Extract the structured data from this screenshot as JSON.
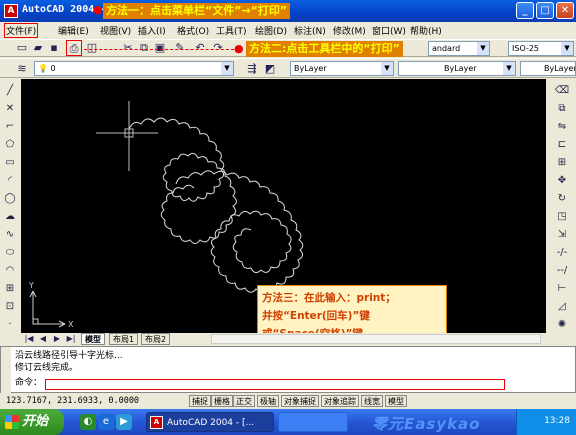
{
  "window": {
    "title": "AutoCAD 2004 -",
    "app_icon": "A",
    "minimize": "_",
    "maximize": "□",
    "close": "✕",
    "colors": {
      "titlebar": "#0a4fd8",
      "canvas": "#000000",
      "annotation_bg": "#e08000",
      "annotation_text": "#ffff00",
      "highlight": "#ee0000"
    }
  },
  "annotations": {
    "method1": "方法一：点击菜单栏“文件”→“打印”",
    "method2": "方法二:点击工具栏中的“打印”",
    "arrow": "●"
  },
  "menubar": {
    "items": [
      "文件(F)",
      "编辑(E)",
      "视图(V)",
      "插入(I)",
      "格式(O)",
      "工具(T)",
      "绘图(D)",
      "标注(N)",
      "修改(M)",
      "窗口(W)",
      "帮助(H)"
    ]
  },
  "toolbar": {
    "icons": [
      "new-icon",
      "open-icon",
      "save-icon",
      "print-icon",
      "preview-icon",
      "cut-icon",
      "copy-icon",
      "paste-icon",
      "matchprop-icon",
      "undo-icon",
      "redo-icon"
    ],
    "text_style": "andard",
    "dim_style": "ISO-25",
    "layer": "0",
    "color": "ByLayer",
    "linetype": "ByLayer",
    "lineweight": "ByLayer"
  },
  "canvas": {
    "ucs_y": "Y",
    "ucs_x": "X",
    "tip_lines": [
      "方法三：在此输入：print；",
      "并按“Enter(回车)”键",
      "或“Space(空格)”键"
    ]
  },
  "tabs": {
    "model": "模型",
    "layout1": "布局1",
    "layout2": "布局2"
  },
  "command": {
    "history": [
      "沿云线路径引导十字光标...",
      "修订云线完成。"
    ],
    "prompt": "命令："
  },
  "statusbar": {
    "coords": "123.7167, 231.6933, 0.0000",
    "toggles": [
      "捕捉",
      "栅格",
      "正交",
      "极轴",
      "对象捕捉",
      "对象追踪",
      "线宽",
      "模型"
    ]
  },
  "taskbar": {
    "start": "开始",
    "task_active": "AutoCAD 2004 - [...",
    "watermark": "零元Easykao",
    "lang": "CH",
    "clock": "13:28"
  }
}
